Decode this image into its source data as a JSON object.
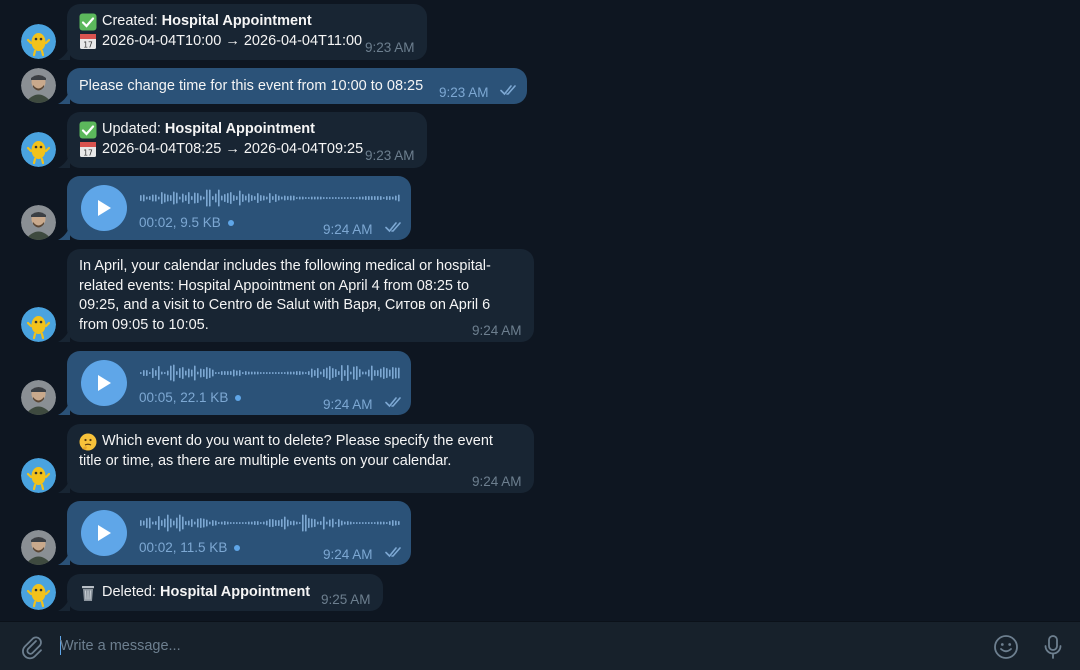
{
  "colors": {
    "background": "#0e1621",
    "incoming_bubble": "#182533",
    "outgoing_bubble": "#2b5278",
    "accent": "#5fa6e8",
    "muted_text": "#6d7f8f"
  },
  "messages": [
    {
      "direction": "incoming",
      "sender": "bot",
      "lines": [
        {
          "emoji": "check-mark-icon",
          "prefix": "Created: ",
          "bold": "Hospital Appointment"
        },
        {
          "emoji": "calendar-icon",
          "prefix": "2026-04-04T10:00 → 2026-04-04T11:00",
          "bold": ""
        }
      ],
      "time": "9:23 AM"
    },
    {
      "direction": "outgoing",
      "sender": "user",
      "text": "Please change time for this event from 10:00 to 08:25",
      "time": "9:23 AM",
      "status": "read"
    },
    {
      "direction": "incoming",
      "sender": "bot",
      "lines": [
        {
          "emoji": "check-mark-icon",
          "prefix": "Updated: ",
          "bold": "Hospital Appointment"
        },
        {
          "emoji": "calendar-icon",
          "prefix": "2026-04-04T08:25 → 2026-04-04T09:25",
          "bold": ""
        }
      ],
      "time": "9:23 AM"
    },
    {
      "direction": "outgoing",
      "sender": "user",
      "type": "voice",
      "duration": "00:02",
      "size": "9.5 KB",
      "meta": "00:02, 9.5 KB",
      "time": "9:24 AM",
      "status": "read"
    },
    {
      "direction": "incoming",
      "sender": "bot",
      "paragraph_lines": [
        "In April, your calendar includes the following medical or hospital-",
        "related events: Hospital Appointment on April 4 from 08:25 to",
        "09:25, and a visit to Centro de Salut with Варя, Ситов on April 6",
        "from 09:05 to 10:05."
      ],
      "time": "9:24 AM"
    },
    {
      "direction": "outgoing",
      "sender": "user",
      "type": "voice",
      "duration": "00:05",
      "size": "22.1 KB",
      "meta": "00:05, 22.1 KB",
      "time": "9:24 AM",
      "status": "read"
    },
    {
      "direction": "incoming",
      "sender": "bot",
      "emoji": "thinking-face-icon",
      "paragraph_lines": [
        "Which event do you want to delete? Please specify the event",
        "title or time, as there are multiple events on your calendar."
      ],
      "time": "9:24 AM"
    },
    {
      "direction": "outgoing",
      "sender": "user",
      "type": "voice",
      "duration": "00:02",
      "size": "11.5 KB",
      "meta": "00:02, 11.5 KB",
      "time": "9:24 AM",
      "status": "read"
    },
    {
      "direction": "incoming",
      "sender": "bot",
      "lines": [
        {
          "emoji": "wastebasket-icon",
          "prefix": "Deleted: ",
          "bold": "Hospital Appointment"
        }
      ],
      "time": "9:25 AM"
    }
  ],
  "composer": {
    "placeholder": "Write a message...",
    "value": ""
  }
}
